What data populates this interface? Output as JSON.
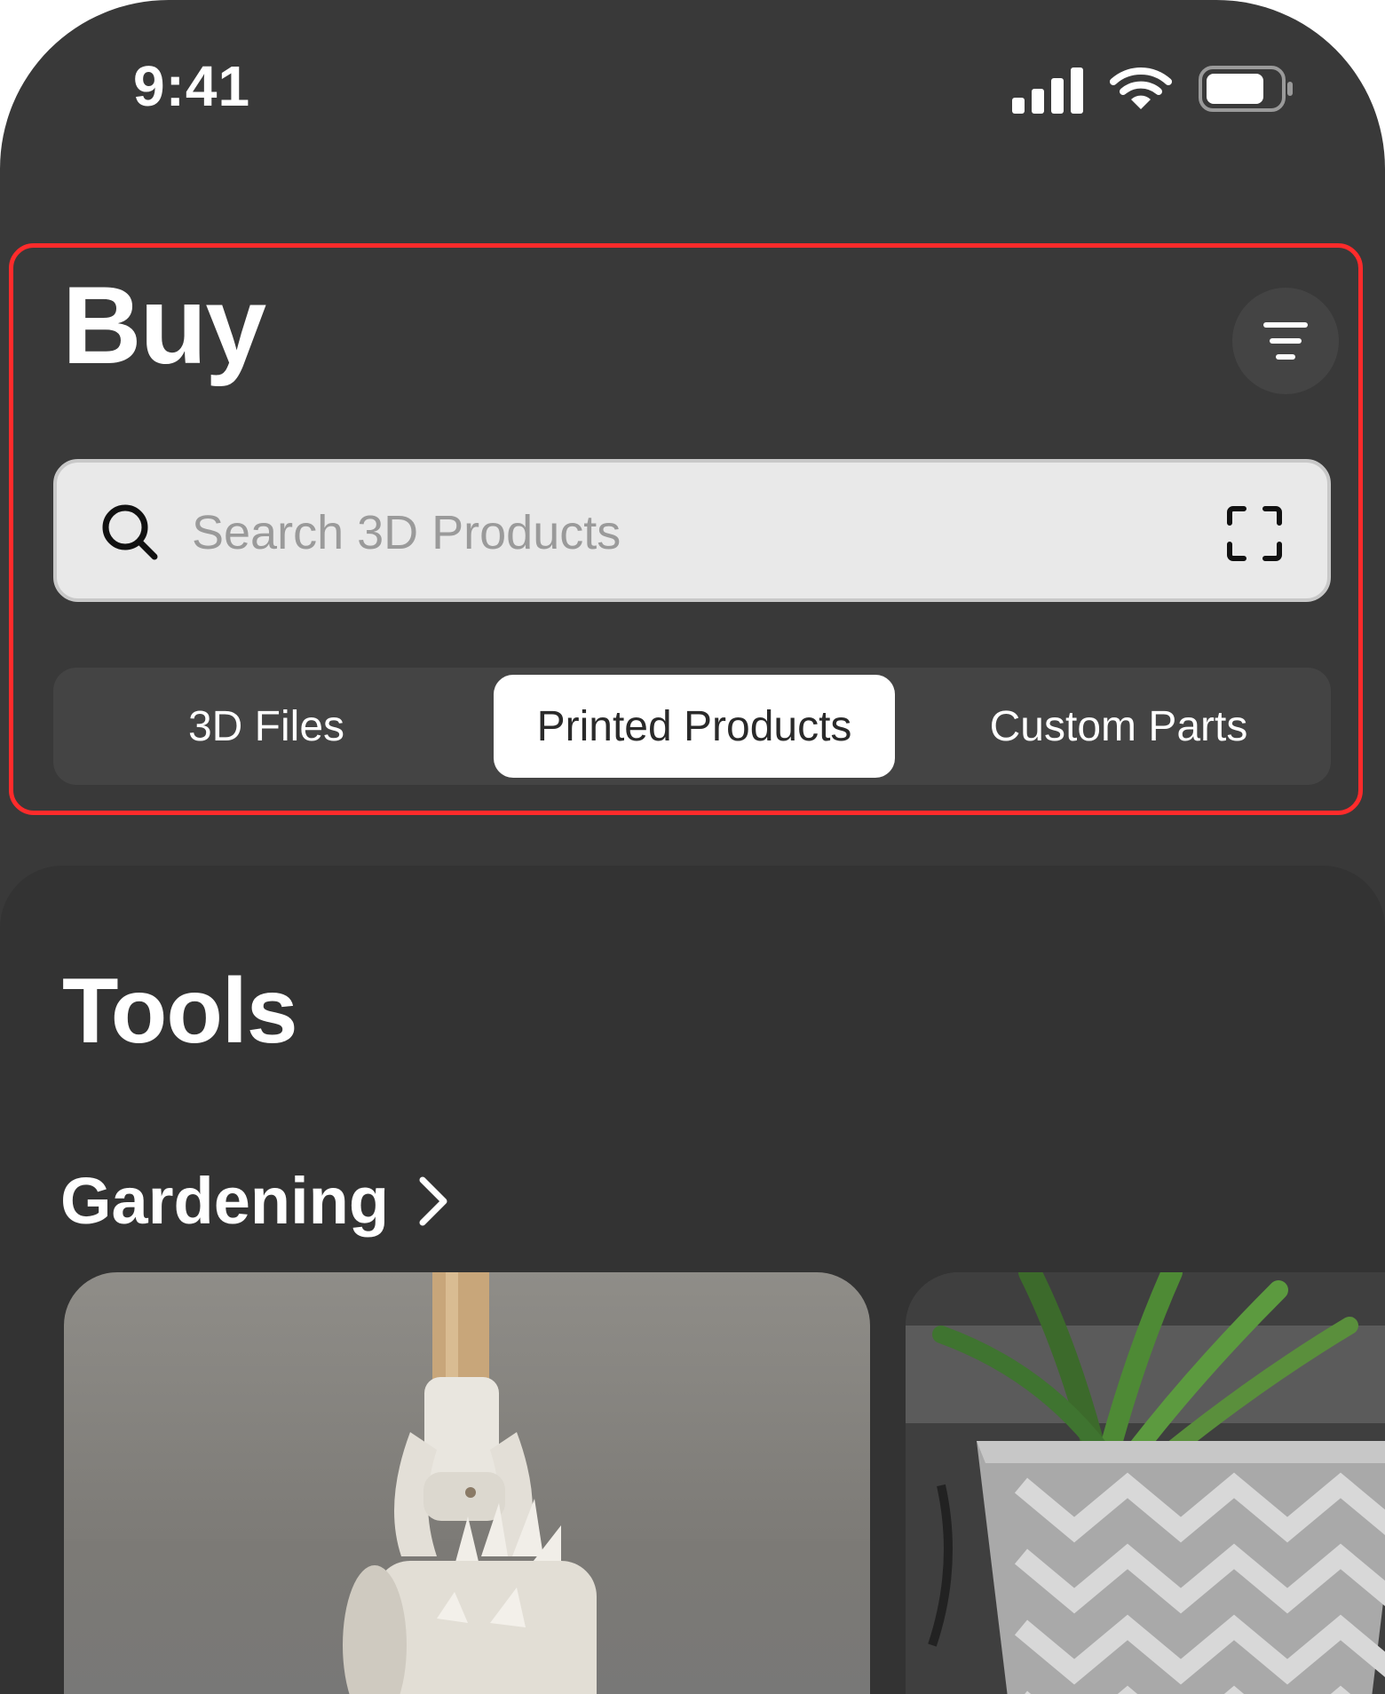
{
  "status_bar": {
    "time": "9:41"
  },
  "header": {
    "title": "Buy"
  },
  "search": {
    "placeholder": "Search 3D Products",
    "value": ""
  },
  "tabs": [
    {
      "label": "3D Files",
      "active": false
    },
    {
      "label": "Printed Products",
      "active": true
    },
    {
      "label": "Custom Parts",
      "active": false
    }
  ],
  "section": {
    "title": "Tools"
  },
  "category": {
    "label": "Gardening"
  },
  "colors": {
    "highlight": "#ff2b2b",
    "background": "#393939"
  },
  "icons": [
    "cellular-signal-icon",
    "wifi-icon",
    "battery-icon",
    "filter-icon",
    "search-icon",
    "scan-icon",
    "chevron-right-icon"
  ]
}
